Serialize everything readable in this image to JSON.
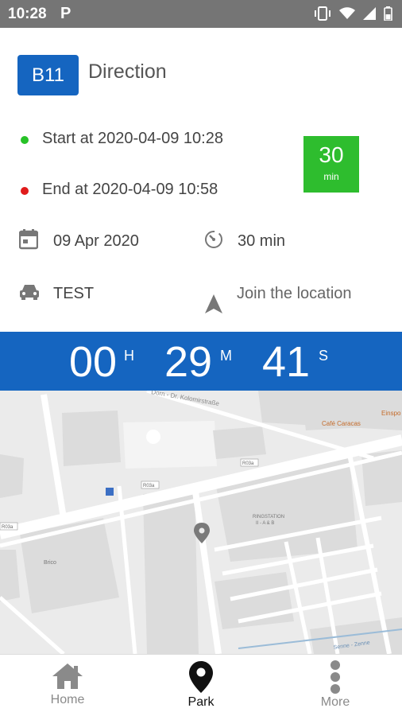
{
  "status_bar": {
    "time": "10:28",
    "notification_icon": "P"
  },
  "header": {
    "badge": "B11",
    "title": "Direction"
  },
  "parking": {
    "start": "Start at 2020-04-09 10:28",
    "end": "End at 2020-04-09 10:58",
    "duration_value": "30",
    "duration_unit": "min",
    "date": "09 Apr 2020",
    "duration_text": "30 min",
    "vehicle": "TEST",
    "join_location": "Join the location"
  },
  "timer": {
    "hours": "00",
    "hours_unit": "H",
    "minutes": "29",
    "minutes_unit": "M",
    "seconds": "41",
    "seconds_unit": "S"
  },
  "map": {
    "labels": {
      "street_top": "Dorn - Dr. Kolomirstraße",
      "cafe": "Café Caracas",
      "corner": "Einspo",
      "road1": "R03a",
      "road2": "R03a",
      "road3": "R03a",
      "station": "RINGSTATION",
      "station_sub": "II - A & B",
      "brico": "Brico",
      "river": "Senne - Zenne"
    }
  },
  "bottom_nav": {
    "items": [
      {
        "label": "Home",
        "icon": "home-icon"
      },
      {
        "label": "Park",
        "icon": "location-pin-icon"
      },
      {
        "label": "More",
        "icon": "more-vertical-icon"
      }
    ]
  },
  "colors": {
    "primary_blue": "#1565c0",
    "green": "#2ebd2e",
    "status_bar": "#757575"
  }
}
